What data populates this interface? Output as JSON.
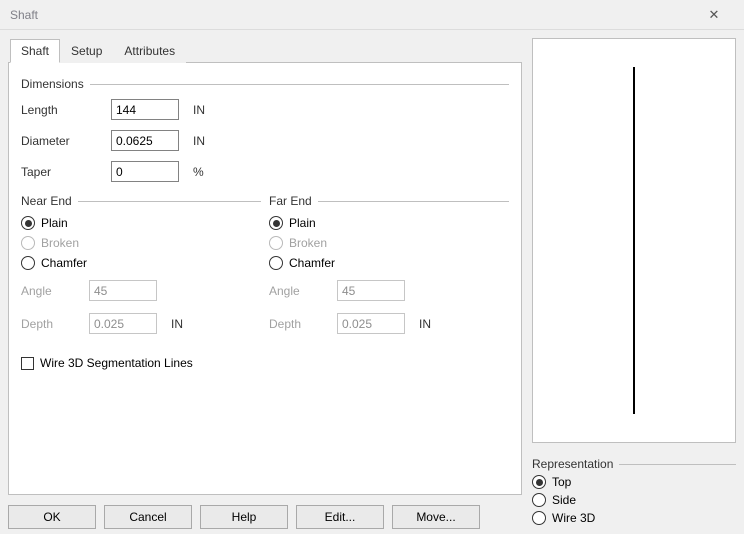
{
  "window": {
    "title": "Shaft"
  },
  "tabs": {
    "shaft": "Shaft",
    "setup": "Setup",
    "attributes": "Attributes"
  },
  "dim": {
    "group": "Dimensions",
    "length_lbl": "Length",
    "length_val": "144",
    "length_unit": "IN",
    "diameter_lbl": "Diameter",
    "diameter_val": "0.0625",
    "diameter_unit": "IN",
    "taper_lbl": "Taper",
    "taper_val": "0",
    "taper_unit": "%"
  },
  "near": {
    "group": "Near End",
    "plain": "Plain",
    "broken": "Broken",
    "chamfer": "Chamfer",
    "angle_lbl": "Angle",
    "angle_val": "45",
    "depth_lbl": "Depth",
    "depth_val": "0.025",
    "depth_unit": "IN"
  },
  "far": {
    "group": "Far End",
    "plain": "Plain",
    "broken": "Broken",
    "chamfer": "Chamfer",
    "angle_lbl": "Angle",
    "angle_val": "45",
    "depth_lbl": "Depth",
    "depth_val": "0.025",
    "depth_unit": "IN"
  },
  "seg": {
    "label": "Wire 3D Segmentation Lines"
  },
  "rep": {
    "group": "Representation",
    "top": "Top",
    "side": "Side",
    "wire3d": "Wire 3D"
  },
  "buttons": {
    "ok": "OK",
    "cancel": "Cancel",
    "help": "Help",
    "edit": "Edit...",
    "move": "Move..."
  }
}
